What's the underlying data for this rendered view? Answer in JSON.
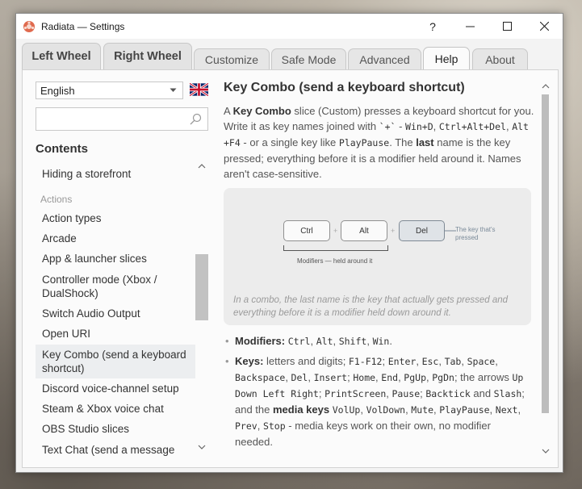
{
  "window": {
    "title": "Radiata — Settings"
  },
  "caption_buttons": {
    "help": "?",
    "minimize": "minimize",
    "maximize": "maximize",
    "close": "close"
  },
  "tabs": [
    {
      "label": "Left Wheel"
    },
    {
      "label": "Right Wheel"
    },
    {
      "label": "Customize"
    },
    {
      "label": "Safe Mode"
    },
    {
      "label": "Advanced"
    },
    {
      "label": "Help",
      "active": true
    },
    {
      "label": "About"
    }
  ],
  "sidebar": {
    "language": "English",
    "search": {
      "value": "",
      "placeholder": ""
    },
    "contents_heading": "Contents",
    "items": [
      {
        "label": "Hiding a storefront"
      },
      {
        "label": "Actions",
        "section": true
      },
      {
        "label": "Action types"
      },
      {
        "label": "Arcade"
      },
      {
        "label": "App & launcher slices"
      },
      {
        "label": "Controller mode (Xbox / DualShock)"
      },
      {
        "label": "Switch Audio Output"
      },
      {
        "label": "Open URI"
      },
      {
        "label": "Key Combo (send a keyboard shortcut)",
        "active": true
      },
      {
        "label": "Discord voice-channel setup"
      },
      {
        "label": "Steam & Xbox voice chat"
      },
      {
        "label": "OBS Studio slices"
      },
      {
        "label": "Text Chat (send a message"
      }
    ]
  },
  "content": {
    "title": "Key Combo (send a keyboard shortcut)",
    "intro": {
      "t1": "A ",
      "b1": "Key Combo",
      "t2": " slice (Custom) presses a keyboard shortcut for you. Write it as key names joined with ",
      "c1": "`+`",
      "t3": " - ",
      "c2": "Win+D",
      "t4": ", ",
      "c3": "Ctrl+Alt+Del",
      "t5": ", ",
      "c4": "Alt +F4",
      "t6": " - or a single key like ",
      "c5": "PlayPause",
      "t7": ". The ",
      "b2": "last",
      "t8": " name is the key pressed; everything before it is a modifier held around it. Names aren't case-sensitive."
    },
    "figure": {
      "keys": [
        "Ctrl",
        "Alt",
        "Del"
      ],
      "plus": "+",
      "pressed_note": "The key that's pressed",
      "modifiers_note": "Modifiers — held around it",
      "caption": "In a combo, the last name is the key that actually gets pressed and everything before it is a modifier held down around it."
    },
    "modifiers_line": {
      "label": "Modifiers:",
      "k1": "Ctrl",
      "sep1": ", ",
      "k2": "Alt",
      "sep2": ", ",
      "k3": "Shift",
      "sep3": ", ",
      "k4": "Win",
      "end": "."
    },
    "keys_line": {
      "label": "Keys:",
      "t1": " letters and digits; ",
      "c1": "F1-F12",
      "t2": "; ",
      "c2": "Enter",
      "t3": ", ",
      "c3": "Esc",
      "t4": ", ",
      "c4": "Tab",
      "t5": ", ",
      "c5": "Space",
      "t6": ", ",
      "c6": "Backspace",
      "t7": ", ",
      "c7": "Del",
      "t8": ", ",
      "c8": "Insert",
      "t9": "; ",
      "c9": "Home",
      "t10": ", ",
      "c10": "End",
      "t11": ", ",
      "c11": "PgUp",
      "t12": ", ",
      "c12": "PgDn",
      "t13": "; the arrows ",
      "c13": "Up Down Left Right",
      "t14": "; ",
      "c14": "PrintScreen",
      "t15": ", ",
      "c15": "Pause",
      "t16": "; ",
      "c16": "Backtick",
      "t17": " and ",
      "c17": "Slash",
      "t18": "; and the ",
      "b1": "media keys",
      "t19": " ",
      "c18": "VolUp",
      "t20": ", ",
      "c19": "VolDown",
      "t21": ", ",
      "c20": "Mute",
      "t22": ", ",
      "c21": "PlayPause",
      "t23": ", ",
      "c22": "Next",
      "t24": ", ",
      "c23": "Prev",
      "t25": ", ",
      "c24": "Stop",
      "t26": " - media keys work on their own, no modifier needed."
    }
  },
  "colors": {
    "accent_icon": "#e06a4e",
    "active_toc_bg": "#eceef0",
    "del_key_bg": "#dfe3e7"
  }
}
